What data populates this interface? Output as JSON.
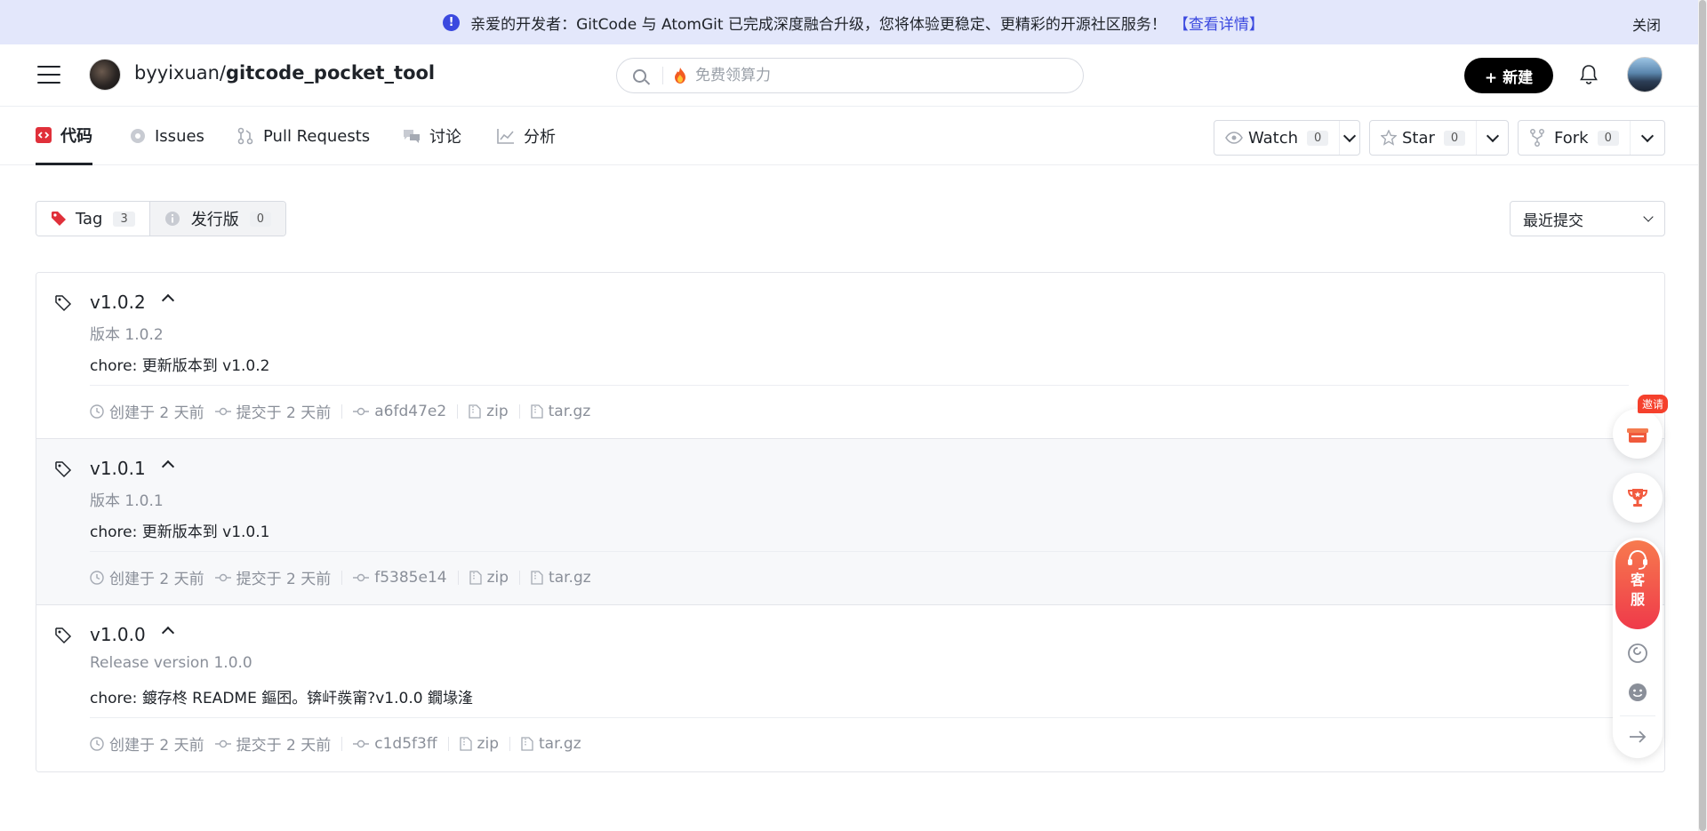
{
  "banner": {
    "info_icon": "info-circle-icon",
    "text": "亲爱的开发者：GitCode 与 AtomGit 已完成深度融合升级，您将体验更稳定、更精彩的开源社区服务！",
    "link": "【查看详情】",
    "close": "关闭"
  },
  "header": {
    "owner": "byyixuan/",
    "repo": "gitcode_pocket_tool",
    "search_placeholder": "免费领算力",
    "new_button": "+ 新建"
  },
  "tabs": [
    {
      "label": "代码",
      "icon": "code-icon",
      "active": true
    },
    {
      "label": "Issues",
      "icon": "issue-icon"
    },
    {
      "label": "Pull Requests",
      "icon": "pull-request-icon"
    },
    {
      "label": "讨论",
      "icon": "discussion-icon"
    },
    {
      "label": "分析",
      "icon": "analytics-icon"
    }
  ],
  "repo_actions": {
    "watch": {
      "label": "Watch",
      "count": "0"
    },
    "star": {
      "label": "Star",
      "count": "0"
    },
    "fork": {
      "label": "Fork",
      "count": "0"
    }
  },
  "filter": {
    "tag": {
      "label": "Tag",
      "count": "3"
    },
    "release": {
      "label": "发行版",
      "count": "0"
    },
    "sort": "最近提交"
  },
  "tags": [
    {
      "name": "v1.0.2",
      "title": "版本 1.0.2",
      "message": "chore: 更新版本到 v1.0.2",
      "created": "创建于 2 天前",
      "committed": "提交于 2 天前",
      "sha": "a6fd47e2",
      "zip": "zip",
      "targz": "tar.gz"
    },
    {
      "name": "v1.0.1",
      "title": "版本 1.0.1",
      "message": "chore: 更新版本到 v1.0.1",
      "created": "创建于 2 天前",
      "committed": "提交于 2 天前",
      "sha": "f5385e14",
      "zip": "zip",
      "targz": "tar.gz"
    },
    {
      "name": "v1.0.0",
      "title": "Release version 1.0.0",
      "message": "chore: 鍍存柊 README 鏂囨。锛屽彂甯?v1.0.0 鐗堟湰",
      "created": "创建于 2 天前",
      "committed": "提交于 2 天前",
      "sha": "c1d5f3ff",
      "zip": "zip",
      "targz": "tar.gz"
    }
  ],
  "float_bar": {
    "invite": "邀请",
    "service_line1": "客",
    "service_line2": "服"
  },
  "colors": {
    "banner_bg": "#e3e7fb",
    "link": "#3b49df",
    "active_tab_icon": "#e0303a",
    "service_gradient_top": "#f77a4e",
    "service_gradient_bottom": "#ef3a4a"
  }
}
